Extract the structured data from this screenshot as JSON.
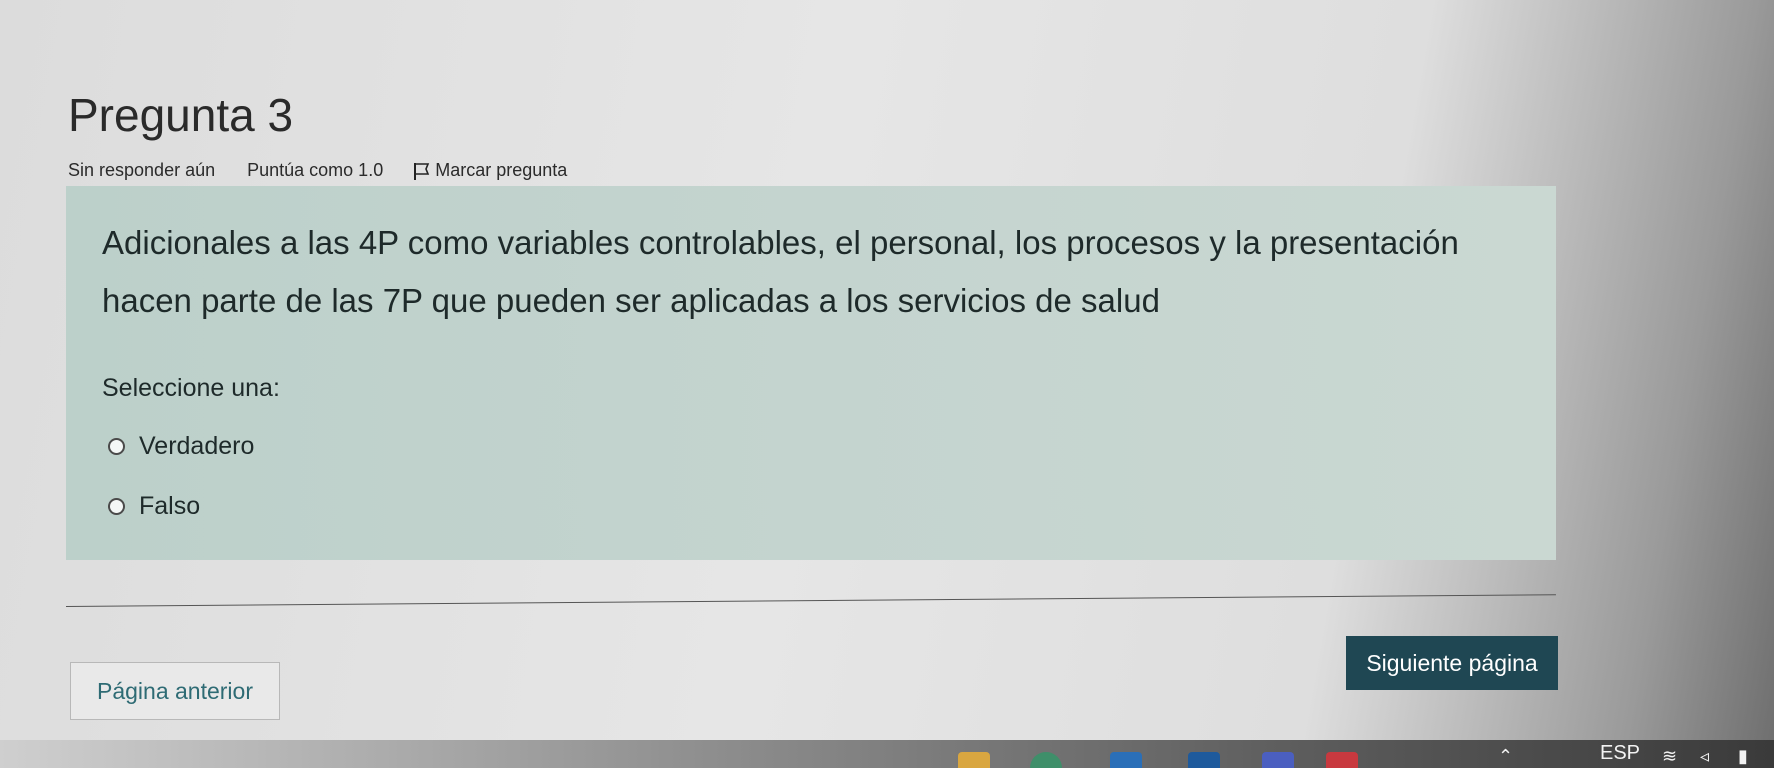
{
  "question": {
    "title": "Pregunta 3",
    "status": "Sin responder aún",
    "score": "Puntúa como 1.0",
    "flag_label": "Marcar pregunta",
    "text": "Adicionales a las 4P como variables controlables, el personal, los procesos y la presentación hacen parte de las 7P que pueden ser aplicadas a los servicios de salud",
    "prompt": "Seleccione una:",
    "options": [
      {
        "label": "Verdadero",
        "selected": false
      },
      {
        "label": "Falso",
        "selected": false
      }
    ]
  },
  "navigation": {
    "prev_label": "Página anterior",
    "next_label": "Siguiente página"
  },
  "taskbar": {
    "language": "ESP",
    "tray_icons": [
      "chevron-up-icon",
      "wifi-icon",
      "volume-icon",
      "battery-icon"
    ]
  },
  "colors": {
    "question_box": "#c4d4cf",
    "next_button": "#1f4753",
    "prev_button_text": "#2e6b74"
  }
}
